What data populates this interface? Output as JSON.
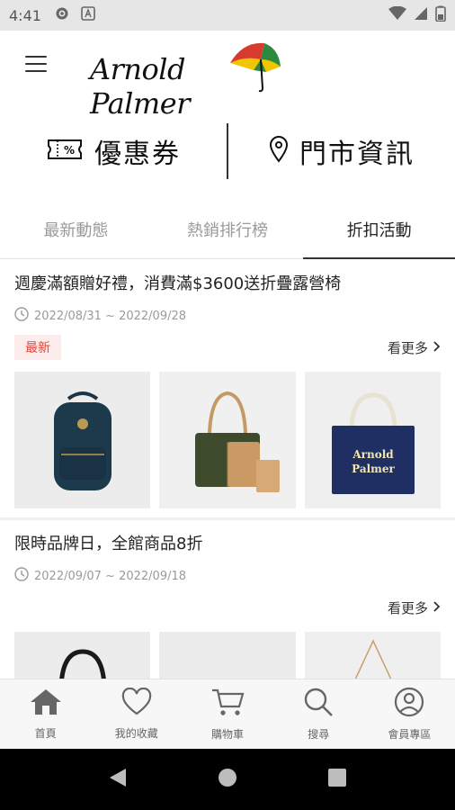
{
  "status_bar": {
    "time": "4:41"
  },
  "header": {
    "brand": "Arnold Palmer"
  },
  "quick_links": {
    "coupon_label": "優惠券",
    "coupon_icon_text": "%",
    "store_label": "門市資訊"
  },
  "tabs": [
    {
      "label": "最新動態",
      "active": false
    },
    {
      "label": "熱銷排行榜",
      "active": false
    },
    {
      "label": "折扣活動",
      "active": true
    }
  ],
  "promotions": [
    {
      "title": "週慶滿額贈好禮，消費滿$3600送折疊露營椅",
      "date_range": "2022/08/31 ~ 2022/09/28",
      "badge": "最新",
      "see_more": "看更多",
      "product_tote_text": [
        "Arnold",
        "Palmer"
      ]
    },
    {
      "title": "限時品牌日，全館商品8折",
      "date_range": "2022/09/07 ~ 2022/09/18",
      "see_more": "看更多"
    }
  ],
  "bottom_nav": [
    {
      "label": "首頁",
      "icon": "home-icon"
    },
    {
      "label": "我的收藏",
      "icon": "heart-icon"
    },
    {
      "label": "購物車",
      "icon": "cart-icon"
    },
    {
      "label": "搜尋",
      "icon": "search-icon"
    },
    {
      "label": "會員專區",
      "icon": "user-icon"
    }
  ],
  "colors": {
    "accent": "#333333",
    "badge_bg": "#fdecec",
    "badge_text": "#e2453c",
    "muted_text": "#9a9a9a"
  }
}
